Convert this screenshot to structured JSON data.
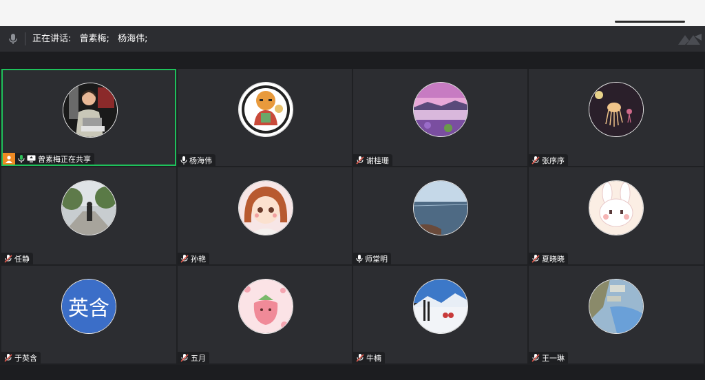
{
  "speaking_bar": {
    "label": "正在讲话:",
    "speakers": [
      "曾素梅;",
      "杨海伟;"
    ]
  },
  "participants": [
    {
      "name": "曾素梅正在共享",
      "mic": "active",
      "avatar": "photo-woman",
      "active": true
    },
    {
      "name": "杨海伟",
      "mic": "on",
      "avatar": "tiger-cartoon"
    },
    {
      "name": "谢桂珊",
      "mic": "muted",
      "avatar": "lake-landscape"
    },
    {
      "name": "张序序",
      "mic": "muted",
      "avatar": "jellyfish"
    },
    {
      "name": "任静",
      "mic": "muted",
      "avatar": "street-photo"
    },
    {
      "name": "孙艳",
      "mic": "muted",
      "avatar": "cartoon-girl"
    },
    {
      "name": "师堂明",
      "mic": "on",
      "avatar": "sea-view"
    },
    {
      "name": "夏晓晓",
      "mic": "muted",
      "avatar": "bunny-cartoon"
    },
    {
      "name": "于英含",
      "mic": "muted",
      "avatar": "text",
      "avatar_text": "英含"
    },
    {
      "name": "五月",
      "mic": "muted",
      "avatar": "strawberry-cartoon"
    },
    {
      "name": "牛楠",
      "mic": "muted",
      "avatar": "snow-mountain"
    },
    {
      "name": "王一琳",
      "mic": "muted",
      "avatar": "pond-photo"
    }
  ],
  "colors": {
    "active_border": "#1ec15b",
    "tile_bg": "#2c2d31",
    "muted_icon": "#e05a4f",
    "share_orange": "#ef8a23",
    "mic_green": "#2fc15a",
    "text_avatar_bg": "#3b6ec8"
  }
}
